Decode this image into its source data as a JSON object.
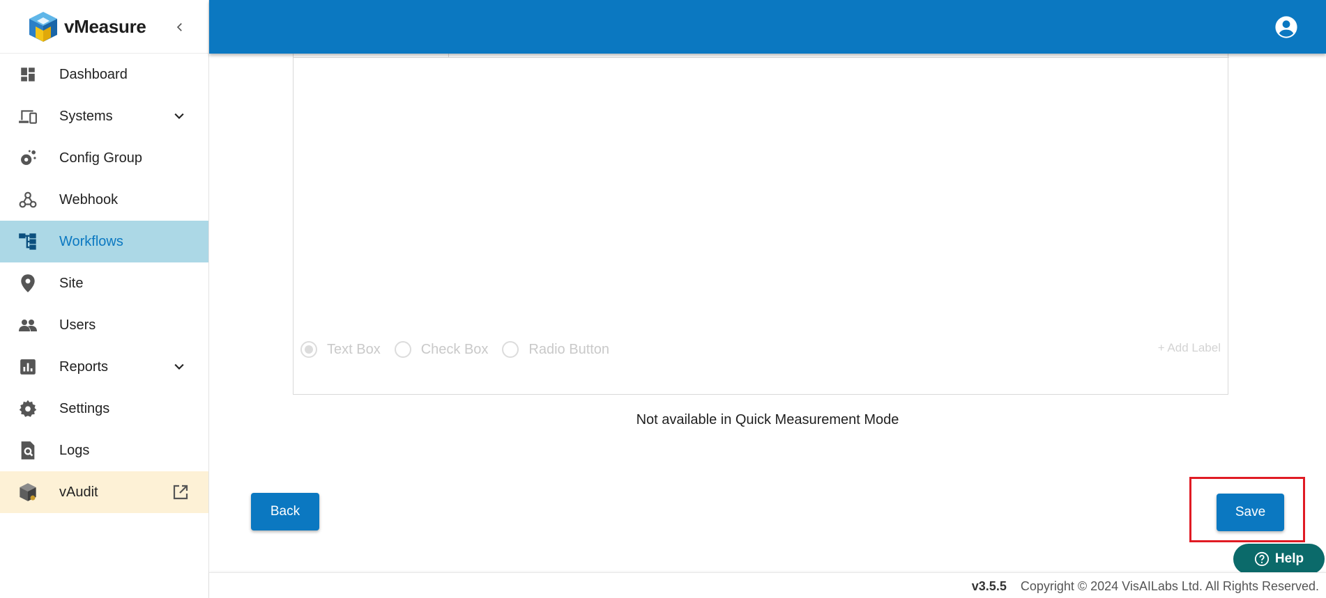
{
  "app": {
    "name": "vMeasure"
  },
  "sidebar": {
    "items": [
      {
        "label": "Dashboard",
        "icon": "dashboard-icon"
      },
      {
        "label": "Systems",
        "icon": "devices-icon",
        "expandable": true
      },
      {
        "label": "Config Group",
        "icon": "config-gear-icon"
      },
      {
        "label": "Webhook",
        "icon": "webhook-icon"
      },
      {
        "label": "Workflows",
        "icon": "workflow-icon",
        "active": true
      },
      {
        "label": "Site",
        "icon": "location-pin-icon"
      },
      {
        "label": "Users",
        "icon": "users-icon"
      },
      {
        "label": "Reports",
        "icon": "bar-chart-icon",
        "expandable": true
      },
      {
        "label": "Settings",
        "icon": "gear-icon"
      },
      {
        "label": "Logs",
        "icon": "search-document-icon"
      },
      {
        "label": "vAudit",
        "icon": "cube-icon",
        "external": true
      }
    ]
  },
  "form": {
    "options": [
      {
        "label": "Text Box",
        "selected": true
      },
      {
        "label": "Check Box",
        "selected": false
      },
      {
        "label": "Radio Button",
        "selected": false
      }
    ],
    "add_label": "+ Add Label"
  },
  "notice": "Not available in Quick Measurement Mode",
  "actions": {
    "back": "Back",
    "save": "Save"
  },
  "help": {
    "label": "Help"
  },
  "footer": {
    "version": "v3.5.5",
    "copyright": "Copyright © 2024 VisAILabs Ltd. All Rights Reserved."
  },
  "colors": {
    "primary": "#0b78c1",
    "active_bg": "#acd8e6",
    "external_bg": "#fdf1d6",
    "help_bg": "#0b6a6a",
    "highlight": "#e01b24"
  }
}
